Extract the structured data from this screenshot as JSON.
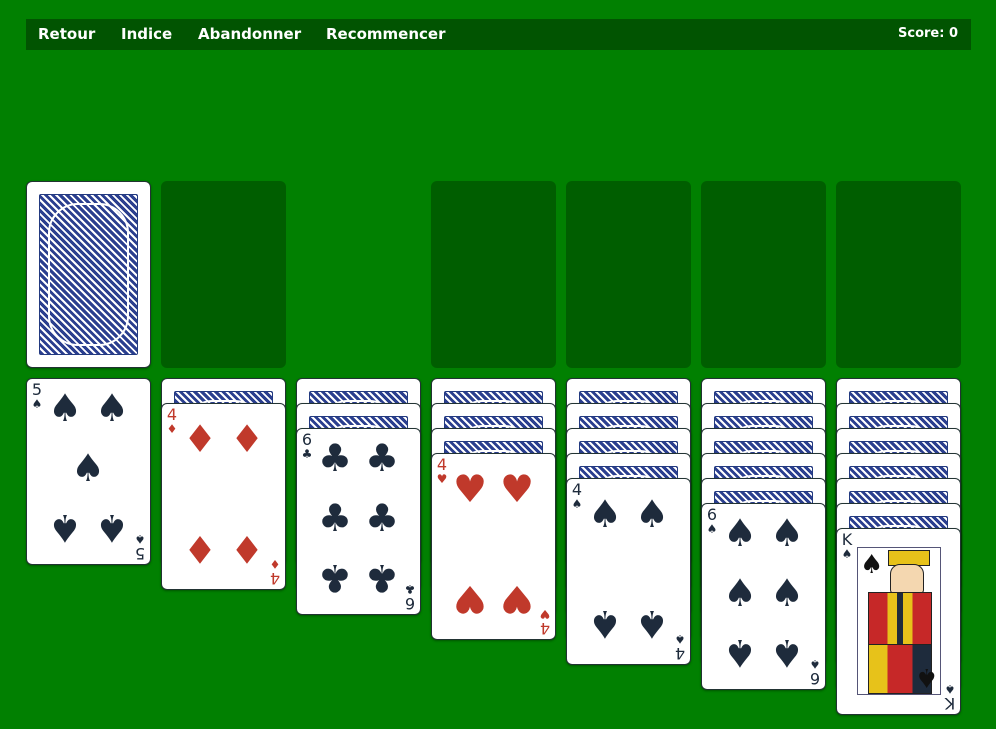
{
  "toolbar": {
    "undo_label": "Retour",
    "hint_label": "Indice",
    "forfeit_label": "Abandonner",
    "restart_label": "Recommencer",
    "score_text": "Score: 0"
  },
  "colors": {
    "table": "#018001",
    "toolbar": "#015401",
    "empty_slot": "#005e00",
    "red_suit": "#c0392b",
    "black_suit": "#1e2b3c"
  },
  "stock": {
    "face_down": true
  },
  "tableau": [
    {
      "hidden": 0,
      "top": {
        "rank": "5",
        "suit": "♠",
        "color": "black"
      }
    },
    {
      "hidden": 1,
      "top": {
        "rank": "4",
        "suit": "♦",
        "color": "red"
      }
    },
    {
      "hidden": 2,
      "top": {
        "rank": "6",
        "suit": "♣",
        "color": "black"
      }
    },
    {
      "hidden": 3,
      "top": {
        "rank": "4",
        "suit": "♥",
        "color": "red"
      }
    },
    {
      "hidden": 4,
      "top": {
        "rank": "4",
        "suit": "♠",
        "color": "black"
      }
    },
    {
      "hidden": 5,
      "top": {
        "rank": "6",
        "suit": "♠",
        "color": "black"
      }
    },
    {
      "hidden": 6,
      "top": {
        "rank": "K",
        "suit": "♠",
        "color": "black"
      }
    }
  ]
}
